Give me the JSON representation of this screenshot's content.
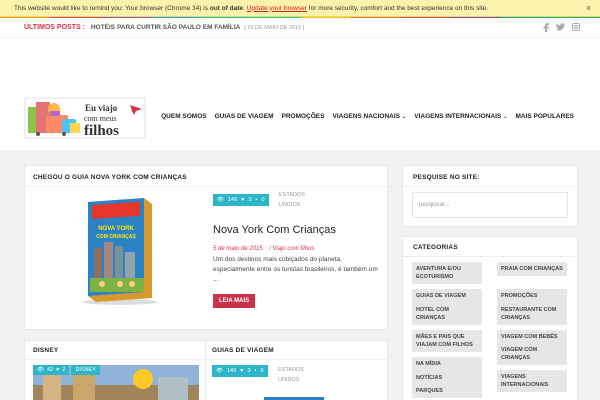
{
  "notice": {
    "part1": "This website would like to remind you: Your browser (Chrome 34) is ",
    "bold": "out of date",
    "part2": ". ",
    "link": "Update your browser",
    "part3": " for more security, comfort and the best experience on this site.",
    "close": "×"
  },
  "colors": {
    "accent": "#d9304a",
    "teal": "#2db6c8",
    "button": "#c9334a"
  },
  "colorline": [
    "#f39c12",
    "#e74c3c",
    "#9b59b6",
    "#3498db",
    "#1abc9c",
    "#2ecc71",
    "#f1c40f",
    "#e67e22",
    "#e74c3c",
    "#8e44ad",
    "#16a085",
    "#27ae60"
  ],
  "topbar": {
    "label": "ÚLTIMOS POSTS :",
    "title": "HOTÉIS PARA CURTIR SÃO PAULO EM FAMÍLIA",
    "date": "[ 20 DE MAIO DE 2015 ]",
    "social": [
      "f",
      "t",
      "ig"
    ]
  },
  "logo": {
    "line1": "Eu viajo",
    "line2": "com meus",
    "line3": "filhos"
  },
  "nav": {
    "items": [
      {
        "label": "QUEM SOMOS",
        "chev": ""
      },
      {
        "label": "GUIAS DE VIAGEM",
        "chev": ""
      },
      {
        "label": "PROMOÇÕES",
        "chev": ""
      },
      {
        "label": "VIAGENS NACIONAIS",
        "chev": "⌄"
      },
      {
        "label": "VIAGENS INTERNACIONAIS",
        "chev": "⌄"
      },
      {
        "label": "MAIS POPULARES",
        "chev": ""
      }
    ]
  },
  "featured": {
    "section_title": "CHEGOU O GUIA NOVA YORK COM CRIANÇAS",
    "views": "149",
    "likes": "3",
    "comments": "0",
    "category": "ESTADOS UNIDOS",
    "title": "Nova York Com Crianças",
    "date": "5 de maio de 2015",
    "author": "/ Viajo com filhos",
    "excerpt": "Um dos destinos mais cobiçados do planeta, especialmente entre os turistas brasileiros, é também um ...",
    "readmore": "LEIA MAIS",
    "book_title_1": "NOVA YORK",
    "book_title_2": "COM CRIANÇAS"
  },
  "disney": {
    "section_title": "DISNEY",
    "views": "42",
    "likes": "2",
    "badge": "DISNEY"
  },
  "guias": {
    "section_title": "GUIAS DE VIAGEM",
    "views": "149",
    "likes": "3",
    "comments": "0",
    "category": "ESTADOS UNIDOS"
  },
  "sidebar": {
    "search_title": "PESQUISE NO SITE:",
    "search_placeholder": "pesquisar...",
    "categories_title": "CATEGORIAS",
    "tags": [
      "AVENTURA E/OU ECOTURISMO",
      "PRAIA COM CRIANÇAS",
      "GUIAS DE VIAGEM",
      "PROMOÇÕES",
      "HOTEL COM CRIANÇAS",
      "RESTAURANTE COM CRIANÇAS",
      "MÃES E PAIS QUE VIAJAM COM FILHOS",
      "VIAGEM COM BEBÊS",
      "NA MÍDIA",
      "VIAGEM COM CRIANÇAS",
      "NOTÍCIAS",
      "VIAGENS INTERNACIONAIS",
      "PARQUES",
      ""
    ]
  }
}
